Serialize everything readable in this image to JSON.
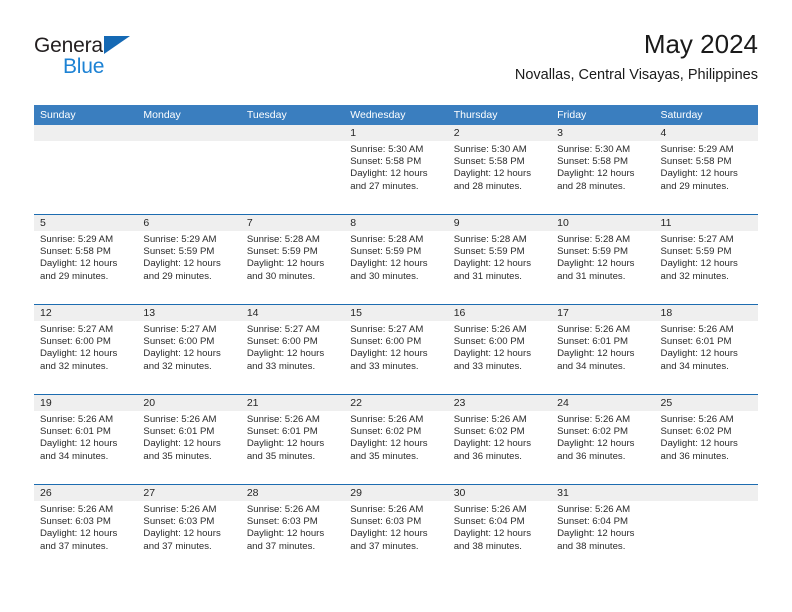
{
  "logo": {
    "word1": "General",
    "word2": "Blue",
    "triangle_icon": "blue-triangle-icon",
    "accent_dark": "#231f20",
    "accent_blue": "#1d82d4"
  },
  "header": {
    "title": "May 2024",
    "subtitle": "Novallas, Central Visayas, Philippines"
  },
  "theme": {
    "header_bar": "#3a7ebf",
    "row_divider": "#1d6cb0",
    "day_number_band": "#efefef",
    "text": "#2b2b2b"
  },
  "weekdays": [
    "Sunday",
    "Monday",
    "Tuesday",
    "Wednesday",
    "Thursday",
    "Friday",
    "Saturday"
  ],
  "weeks": [
    [
      {
        "day": "",
        "empty": true
      },
      {
        "day": "",
        "empty": true
      },
      {
        "day": "",
        "empty": true
      },
      {
        "day": "1",
        "sunrise": "Sunrise: 5:30 AM",
        "sunset": "Sunset: 5:58 PM",
        "daylight_1": "Daylight: 12 hours",
        "daylight_2": "and 27 minutes."
      },
      {
        "day": "2",
        "sunrise": "Sunrise: 5:30 AM",
        "sunset": "Sunset: 5:58 PM",
        "daylight_1": "Daylight: 12 hours",
        "daylight_2": "and 28 minutes."
      },
      {
        "day": "3",
        "sunrise": "Sunrise: 5:30 AM",
        "sunset": "Sunset: 5:58 PM",
        "daylight_1": "Daylight: 12 hours",
        "daylight_2": "and 28 minutes."
      },
      {
        "day": "4",
        "sunrise": "Sunrise: 5:29 AM",
        "sunset": "Sunset: 5:58 PM",
        "daylight_1": "Daylight: 12 hours",
        "daylight_2": "and 29 minutes."
      }
    ],
    [
      {
        "day": "5",
        "sunrise": "Sunrise: 5:29 AM",
        "sunset": "Sunset: 5:58 PM",
        "daylight_1": "Daylight: 12 hours",
        "daylight_2": "and 29 minutes."
      },
      {
        "day": "6",
        "sunrise": "Sunrise: 5:29 AM",
        "sunset": "Sunset: 5:59 PM",
        "daylight_1": "Daylight: 12 hours",
        "daylight_2": "and 29 minutes."
      },
      {
        "day": "7",
        "sunrise": "Sunrise: 5:28 AM",
        "sunset": "Sunset: 5:59 PM",
        "daylight_1": "Daylight: 12 hours",
        "daylight_2": "and 30 minutes."
      },
      {
        "day": "8",
        "sunrise": "Sunrise: 5:28 AM",
        "sunset": "Sunset: 5:59 PM",
        "daylight_1": "Daylight: 12 hours",
        "daylight_2": "and 30 minutes."
      },
      {
        "day": "9",
        "sunrise": "Sunrise: 5:28 AM",
        "sunset": "Sunset: 5:59 PM",
        "daylight_1": "Daylight: 12 hours",
        "daylight_2": "and 31 minutes."
      },
      {
        "day": "10",
        "sunrise": "Sunrise: 5:28 AM",
        "sunset": "Sunset: 5:59 PM",
        "daylight_1": "Daylight: 12 hours",
        "daylight_2": "and 31 minutes."
      },
      {
        "day": "11",
        "sunrise": "Sunrise: 5:27 AM",
        "sunset": "Sunset: 5:59 PM",
        "daylight_1": "Daylight: 12 hours",
        "daylight_2": "and 32 minutes."
      }
    ],
    [
      {
        "day": "12",
        "sunrise": "Sunrise: 5:27 AM",
        "sunset": "Sunset: 6:00 PM",
        "daylight_1": "Daylight: 12 hours",
        "daylight_2": "and 32 minutes."
      },
      {
        "day": "13",
        "sunrise": "Sunrise: 5:27 AM",
        "sunset": "Sunset: 6:00 PM",
        "daylight_1": "Daylight: 12 hours",
        "daylight_2": "and 32 minutes."
      },
      {
        "day": "14",
        "sunrise": "Sunrise: 5:27 AM",
        "sunset": "Sunset: 6:00 PM",
        "daylight_1": "Daylight: 12 hours",
        "daylight_2": "and 33 minutes."
      },
      {
        "day": "15",
        "sunrise": "Sunrise: 5:27 AM",
        "sunset": "Sunset: 6:00 PM",
        "daylight_1": "Daylight: 12 hours",
        "daylight_2": "and 33 minutes."
      },
      {
        "day": "16",
        "sunrise": "Sunrise: 5:26 AM",
        "sunset": "Sunset: 6:00 PM",
        "daylight_1": "Daylight: 12 hours",
        "daylight_2": "and 33 minutes."
      },
      {
        "day": "17",
        "sunrise": "Sunrise: 5:26 AM",
        "sunset": "Sunset: 6:01 PM",
        "daylight_1": "Daylight: 12 hours",
        "daylight_2": "and 34 minutes."
      },
      {
        "day": "18",
        "sunrise": "Sunrise: 5:26 AM",
        "sunset": "Sunset: 6:01 PM",
        "daylight_1": "Daylight: 12 hours",
        "daylight_2": "and 34 minutes."
      }
    ],
    [
      {
        "day": "19",
        "sunrise": "Sunrise: 5:26 AM",
        "sunset": "Sunset: 6:01 PM",
        "daylight_1": "Daylight: 12 hours",
        "daylight_2": "and 34 minutes."
      },
      {
        "day": "20",
        "sunrise": "Sunrise: 5:26 AM",
        "sunset": "Sunset: 6:01 PM",
        "daylight_1": "Daylight: 12 hours",
        "daylight_2": "and 35 minutes."
      },
      {
        "day": "21",
        "sunrise": "Sunrise: 5:26 AM",
        "sunset": "Sunset: 6:01 PM",
        "daylight_1": "Daylight: 12 hours",
        "daylight_2": "and 35 minutes."
      },
      {
        "day": "22",
        "sunrise": "Sunrise: 5:26 AM",
        "sunset": "Sunset: 6:02 PM",
        "daylight_1": "Daylight: 12 hours",
        "daylight_2": "and 35 minutes."
      },
      {
        "day": "23",
        "sunrise": "Sunrise: 5:26 AM",
        "sunset": "Sunset: 6:02 PM",
        "daylight_1": "Daylight: 12 hours",
        "daylight_2": "and 36 minutes."
      },
      {
        "day": "24",
        "sunrise": "Sunrise: 5:26 AM",
        "sunset": "Sunset: 6:02 PM",
        "daylight_1": "Daylight: 12 hours",
        "daylight_2": "and 36 minutes."
      },
      {
        "day": "25",
        "sunrise": "Sunrise: 5:26 AM",
        "sunset": "Sunset: 6:02 PM",
        "daylight_1": "Daylight: 12 hours",
        "daylight_2": "and 36 minutes."
      }
    ],
    [
      {
        "day": "26",
        "sunrise": "Sunrise: 5:26 AM",
        "sunset": "Sunset: 6:03 PM",
        "daylight_1": "Daylight: 12 hours",
        "daylight_2": "and 37 minutes."
      },
      {
        "day": "27",
        "sunrise": "Sunrise: 5:26 AM",
        "sunset": "Sunset: 6:03 PM",
        "daylight_1": "Daylight: 12 hours",
        "daylight_2": "and 37 minutes."
      },
      {
        "day": "28",
        "sunrise": "Sunrise: 5:26 AM",
        "sunset": "Sunset: 6:03 PM",
        "daylight_1": "Daylight: 12 hours",
        "daylight_2": "and 37 minutes."
      },
      {
        "day": "29",
        "sunrise": "Sunrise: 5:26 AM",
        "sunset": "Sunset: 6:03 PM",
        "daylight_1": "Daylight: 12 hours",
        "daylight_2": "and 37 minutes."
      },
      {
        "day": "30",
        "sunrise": "Sunrise: 5:26 AM",
        "sunset": "Sunset: 6:04 PM",
        "daylight_1": "Daylight: 12 hours",
        "daylight_2": "and 38 minutes."
      },
      {
        "day": "31",
        "sunrise": "Sunrise: 5:26 AM",
        "sunset": "Sunset: 6:04 PM",
        "daylight_1": "Daylight: 12 hours",
        "daylight_2": "and 38 minutes."
      },
      {
        "day": "",
        "empty": true
      }
    ]
  ]
}
